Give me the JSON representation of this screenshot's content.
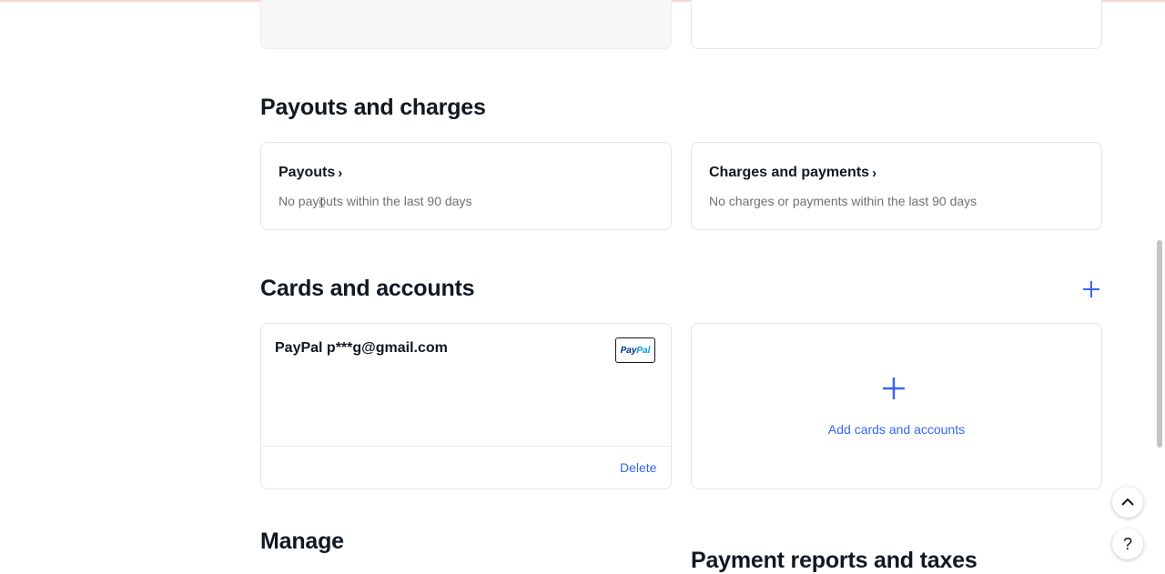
{
  "sections": {
    "payouts_charges": {
      "heading": "Payouts and charges",
      "payouts": {
        "title": "Payouts",
        "description": "No payouts within the last 90 days"
      },
      "charges": {
        "title": "Charges and payments",
        "description": "No charges or payments within the last 90 days"
      }
    },
    "cards_accounts": {
      "heading": "Cards and accounts",
      "paypal_card": {
        "label": "PayPal p***g@gmail.com",
        "logo_part1": "Pay",
        "logo_part2": "Pal",
        "delete_label": "Delete"
      },
      "add_card": {
        "label": "Add cards and accounts",
        "icon": "plus-icon"
      }
    },
    "manage": {
      "heading": "Manage"
    },
    "payment_reports": {
      "heading": "Payment reports and taxes"
    }
  },
  "colors": {
    "accent": "#3665f3",
    "text": "#111820",
    "muted": "#707070",
    "border": "#e5e5e5"
  },
  "floating": {
    "scroll_top_icon": "chevron-up-icon",
    "help_label": "?"
  }
}
